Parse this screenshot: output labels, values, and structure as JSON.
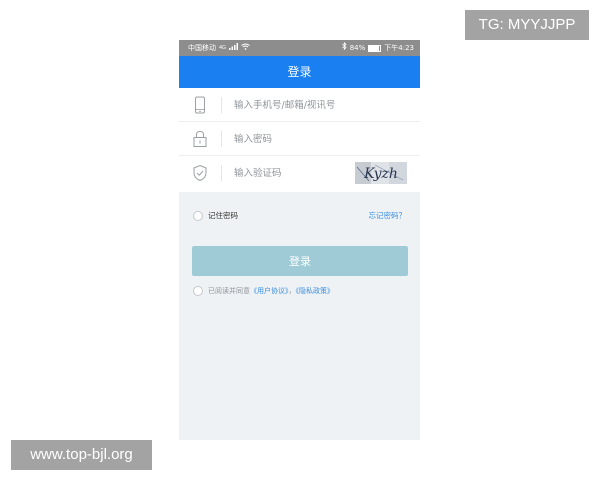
{
  "watermarks": {
    "top_right": "TG: MYYJJPP",
    "bottom_left": "www.top-bjl.org"
  },
  "status_bar": {
    "carrier": "中国移动",
    "signal_label": "4G",
    "battery_text": "84%",
    "battery_level": 0.84,
    "time": "下午4:23",
    "icons": [
      "signal-icon",
      "wifi-icon",
      "bluetooth-icon",
      "battery-icon"
    ]
  },
  "nav": {
    "title": "登录"
  },
  "form": {
    "account": {
      "placeholder": "输入手机号/邮箱/视讯号",
      "value": "",
      "icon": "phone-icon"
    },
    "password": {
      "placeholder": "输入密码",
      "value": "",
      "icon": "lock-icon"
    },
    "captcha": {
      "placeholder": "输入验证码",
      "value": "",
      "icon": "shield-icon",
      "captcha_text": "Kyzh"
    }
  },
  "options": {
    "remember_label": "记住密码",
    "forgot_label": "忘记密码？"
  },
  "login_button": {
    "label": "登录"
  },
  "agreement": {
    "prefix": "已阅读并同意",
    "user_agreement": "《用户协议》",
    "separator": "，",
    "privacy_policy": "《隐私政策》"
  },
  "colors": {
    "status_bar": "#8d8d8d",
    "nav_bar": "#1a7ff0",
    "login_button": "#9fcbd6",
    "link": "#3a8fe0",
    "background": "#eff2f5"
  }
}
